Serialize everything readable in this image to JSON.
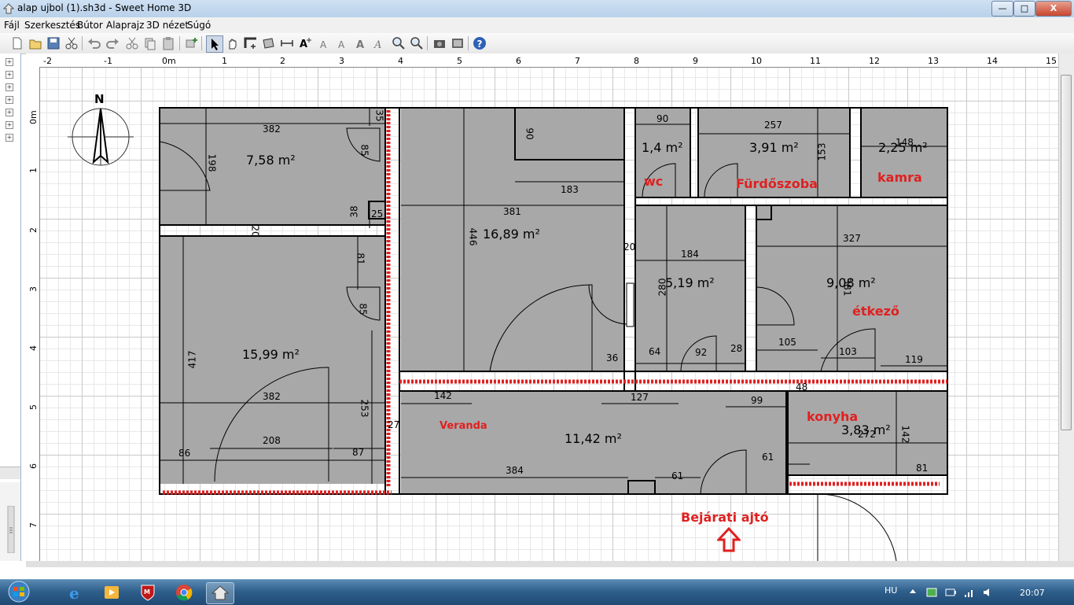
{
  "window": {
    "title": "alap ujbol (1).sh3d - Sweet Home 3D",
    "buttons": {
      "minimize": "—",
      "maximize": "□",
      "close": "X"
    }
  },
  "menubar": [
    "Fájl",
    "Szerkesztés",
    "Bútor",
    "Alaprajz",
    "3D nézet",
    "Súgó"
  ],
  "toolbar": {
    "icons": [
      "new-file-icon",
      "open-file-icon",
      "save-file-icon",
      "cut-icon",
      "undo-icon",
      "redo-icon",
      "cut-icon",
      "copy-icon",
      "paste-icon",
      "add-furniture-icon",
      "select-arrow-icon",
      "pan-hand-icon",
      "create-walls-icon",
      "create-rooms-icon",
      "create-dimensions-icon",
      "add-text-icon",
      "text-style-icon",
      "text-bold-icon",
      "text-italic-icon",
      "zoom-in-icon",
      "zoom-out-icon",
      "create-photo-icon",
      "create-video-icon",
      "help-icon"
    ]
  },
  "rulers": {
    "top": [
      "-2",
      "-1",
      "0m",
      "1",
      "2",
      "3",
      "4",
      "5",
      "6",
      "7",
      "8",
      "9",
      "10",
      "11",
      "12",
      "13",
      "14",
      "15"
    ],
    "left": [
      "0m",
      "1",
      "2",
      "3",
      "4",
      "5",
      "6",
      "7"
    ]
  },
  "compass": {
    "label": "N"
  },
  "rooms": [
    {
      "area": "7,58 m²"
    },
    {
      "area": "15,99 m²"
    },
    {
      "area": "16,89 m²"
    },
    {
      "area": "1,4 m²"
    },
    {
      "area": "3,91 m²"
    },
    {
      "area": "2,25 m²"
    },
    {
      "area": "5,19 m²"
    },
    {
      "area": "9,08 m²"
    },
    {
      "area": "11,42 m²"
    },
    {
      "area": "3,83 m²"
    }
  ],
  "room_labels": [
    "wc",
    "Fürdőszoba",
    "kamra",
    "étkező",
    "Veranda",
    "konyha",
    "Bejárati ajtó"
  ],
  "dimensions": [
    "382",
    "198",
    "85",
    "35",
    "38",
    "25",
    "20",
    "81",
    "85",
    "417",
    "382",
    "253",
    "208",
    "86",
    "87",
    "27",
    "90",
    "183",
    "381",
    "446",
    "20",
    "36",
    "142",
    "127",
    "90",
    "257",
    "153",
    "148",
    "184",
    "280",
    "64",
    "92",
    "28",
    "327",
    "105",
    "103",
    "119",
    "48",
    "99",
    "61",
    "384",
    "61",
    "272",
    "142",
    "81",
    "381"
  ],
  "colors": {
    "room_fill": "#a8a8a8",
    "wall": "#000000",
    "annotation_red": "#e02020",
    "accent_blue": "#1f4a74"
  },
  "taskbar": {
    "apps": [
      "internet-explorer-icon",
      "media-player-icon",
      "mcafee-icon",
      "chrome-icon",
      "sweet-home-3d-icon"
    ],
    "language": "HU",
    "clock": "20:07"
  }
}
